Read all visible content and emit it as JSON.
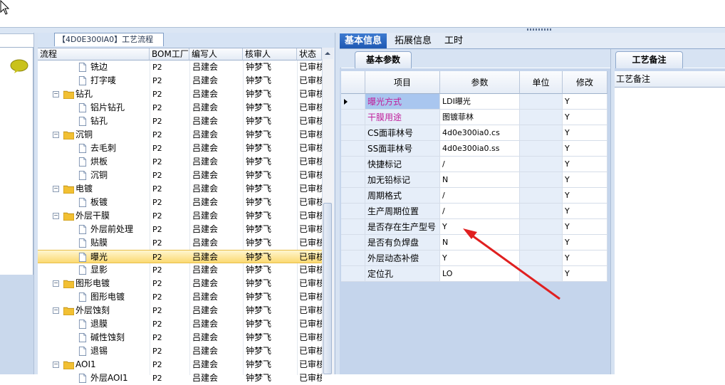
{
  "window": {
    "background": "#ffffff"
  },
  "tree_panel": {
    "title": "【4D0E300IA0】工艺流程",
    "columns": [
      "流程",
      "BOM工厂",
      "编写人",
      "核审人",
      "状态"
    ],
    "rows": [
      {
        "level": 2,
        "type": "doc",
        "name": "铣边",
        "bom": "P2",
        "writer": "吕建会",
        "reviewer": "钟梦飞",
        "status": "已审核"
      },
      {
        "level": 2,
        "type": "doc",
        "name": "打字唛",
        "bom": "P2",
        "writer": "吕建会",
        "reviewer": "钟梦飞",
        "status": "已审核"
      },
      {
        "level": 1,
        "type": "folder",
        "name": "钻孔",
        "bom": "P2",
        "writer": "吕建会",
        "reviewer": "钟梦飞",
        "status": "已审核"
      },
      {
        "level": 2,
        "type": "doc",
        "name": "铝片钻孔",
        "bom": "P2",
        "writer": "吕建会",
        "reviewer": "钟梦飞",
        "status": "已审核"
      },
      {
        "level": 2,
        "type": "doc",
        "name": "钻孔",
        "bom": "P2",
        "writer": "吕建会",
        "reviewer": "钟梦飞",
        "status": "已审核"
      },
      {
        "level": 1,
        "type": "folder",
        "name": "沉铜",
        "bom": "P2",
        "writer": "吕建会",
        "reviewer": "钟梦飞",
        "status": "已审核"
      },
      {
        "level": 2,
        "type": "doc",
        "name": "去毛刺",
        "bom": "P2",
        "writer": "吕建会",
        "reviewer": "钟梦飞",
        "status": "已审核"
      },
      {
        "level": 2,
        "type": "doc",
        "name": "烘板",
        "bom": "P2",
        "writer": "吕建会",
        "reviewer": "钟梦飞",
        "status": "已审核"
      },
      {
        "level": 2,
        "type": "doc",
        "name": "沉铜",
        "bom": "P2",
        "writer": "吕建会",
        "reviewer": "钟梦飞",
        "status": "已审核"
      },
      {
        "level": 1,
        "type": "folder",
        "name": "电镀",
        "bom": "P2",
        "writer": "吕建会",
        "reviewer": "钟梦飞",
        "status": "已审核"
      },
      {
        "level": 2,
        "type": "doc",
        "name": "板镀",
        "bom": "P2",
        "writer": "吕建会",
        "reviewer": "钟梦飞",
        "status": "已审核"
      },
      {
        "level": 1,
        "type": "folder",
        "name": "外层干膜",
        "bom": "P2",
        "writer": "吕建会",
        "reviewer": "钟梦飞",
        "status": "已审核"
      },
      {
        "level": 2,
        "type": "doc",
        "name": "外层前处理",
        "bom": "P2",
        "writer": "吕建会",
        "reviewer": "钟梦飞",
        "status": "已审核"
      },
      {
        "level": 2,
        "type": "doc",
        "name": "贴膜",
        "bom": "P2",
        "writer": "吕建会",
        "reviewer": "钟梦飞",
        "status": "已审核"
      },
      {
        "level": 2,
        "type": "doc",
        "name": "曝光",
        "bom": "P2",
        "writer": "吕建会",
        "reviewer": "钟梦飞",
        "status": "已审核",
        "selected": true
      },
      {
        "level": 2,
        "type": "doc",
        "name": "显影",
        "bom": "P2",
        "writer": "吕建会",
        "reviewer": "钟梦飞",
        "status": "已审核"
      },
      {
        "level": 1,
        "type": "folder",
        "name": "图形电镀",
        "bom": "P2",
        "writer": "吕建会",
        "reviewer": "钟梦飞",
        "status": "已审核"
      },
      {
        "level": 2,
        "type": "doc",
        "name": "图形电镀",
        "bom": "P2",
        "writer": "吕建会",
        "reviewer": "钟梦飞",
        "status": "已审核"
      },
      {
        "level": 1,
        "type": "folder",
        "name": "外层蚀刻",
        "bom": "P2",
        "writer": "吕建会",
        "reviewer": "钟梦飞",
        "status": "已审核"
      },
      {
        "level": 2,
        "type": "doc",
        "name": "退膜",
        "bom": "P2",
        "writer": "吕建会",
        "reviewer": "钟梦飞",
        "status": "已审核"
      },
      {
        "level": 2,
        "type": "doc",
        "name": "碱性蚀刻",
        "bom": "P2",
        "writer": "吕建会",
        "reviewer": "钟梦飞",
        "status": "已审核"
      },
      {
        "level": 2,
        "type": "doc",
        "name": "退锡",
        "bom": "P2",
        "writer": "吕建会",
        "reviewer": "钟梦飞",
        "status": "已审核"
      },
      {
        "level": 1,
        "type": "folder",
        "name": "AOI1",
        "bom": "P2",
        "writer": "吕建会",
        "reviewer": "钟梦飞",
        "status": "已审核"
      },
      {
        "level": 2,
        "type": "doc",
        "name": "外层AOI1",
        "bom": "P2",
        "writer": "吕建会",
        "reviewer": "钟梦飞",
        "status": "已审核"
      }
    ]
  },
  "right_tabs": [
    "基本信息",
    "拓展信息",
    "工时"
  ],
  "basic_params": {
    "tab_label": "基本参数",
    "columns": [
      "项目",
      "参数",
      "单位",
      "修改"
    ],
    "rows": [
      {
        "item": "曝光方式",
        "param": "LDI曝光",
        "unit": "",
        "mod": "Y",
        "highlight": "#c0209c"
      },
      {
        "item": "干膜用途",
        "param": "图镀菲林",
        "unit": "",
        "mod": "Y",
        "highlight": "#c0209c"
      },
      {
        "item": "CS面菲林号",
        "param": "4d0e300ia0.cs",
        "unit": "",
        "mod": "Y"
      },
      {
        "item": "SS面菲林号",
        "param": "4d0e300ia0.ss",
        "unit": "",
        "mod": "Y"
      },
      {
        "item": "快捷标记",
        "param": "/",
        "unit": "",
        "mod": "Y"
      },
      {
        "item": "加无铅标记",
        "param": "N",
        "unit": "",
        "mod": "Y"
      },
      {
        "item": "周期格式",
        "param": "/",
        "unit": "",
        "mod": "Y"
      },
      {
        "item": "生产周期位置",
        "param": "/",
        "unit": "",
        "mod": "Y"
      },
      {
        "item": "是否存在生产型号",
        "param": "Y",
        "unit": "",
        "mod": "Y"
      },
      {
        "item": "是否有负焊盘",
        "param": "N",
        "unit": "",
        "mod": "Y"
      },
      {
        "item": "外层动态补偿",
        "param": "Y",
        "unit": "",
        "mod": "Y"
      },
      {
        "item": "定位孔",
        "param": "LO",
        "unit": "",
        "mod": "Y"
      }
    ]
  },
  "notes": {
    "tab_label": "工艺备注",
    "header": "工艺备注"
  },
  "colors": {
    "accent_tab": "#2a65c0",
    "selection": "#fbd972",
    "arrow": "#e02020"
  }
}
